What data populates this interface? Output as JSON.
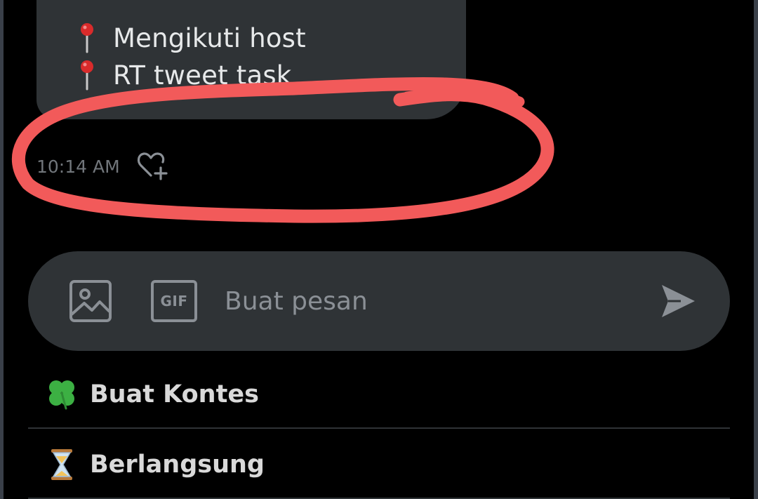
{
  "message": {
    "lines": [
      "Mengikuti host",
      "RT tweet task"
    ],
    "time": "10:14 AM"
  },
  "composer": {
    "gif_label": "GIF",
    "placeholder": "Buat pesan"
  },
  "menu": [
    {
      "label": "Buat Kontes",
      "icon": "clover-icon"
    },
    {
      "label": "Berlangsung",
      "icon": "hourglass-icon"
    }
  ],
  "colors": {
    "background": "#000000",
    "bubble": "#2f3336",
    "annotation": "#f25a5a",
    "muted_text": "#8b9096"
  }
}
